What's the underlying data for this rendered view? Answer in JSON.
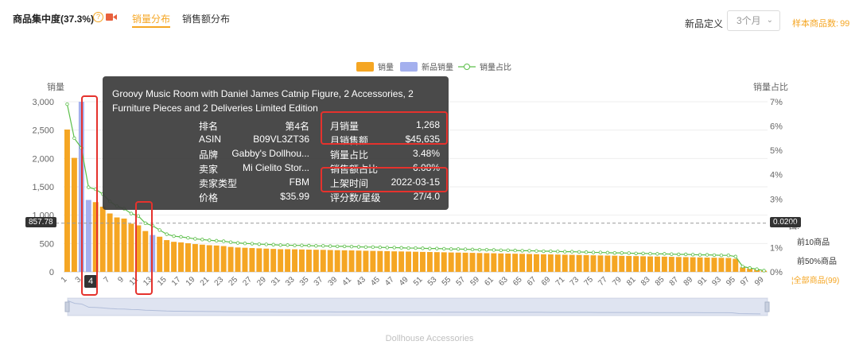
{
  "header": {
    "title": "商品集中度(37.3%)",
    "tabs": [
      {
        "label": "销量分布",
        "active": true
      },
      {
        "label": "销售额分布",
        "active": false
      }
    ],
    "newdef_label": "新品定义",
    "newdef_value": "3个月",
    "sample_label": "样本商品数:",
    "sample_count": "99"
  },
  "tooltip": {
    "name_line1": "Groovy Music Room with Daniel James Catnip Figure, 2 Accessories, 2",
    "name_line2": "Furniture Pieces and 2 Deliveries Limited Edition",
    "left": [
      {
        "k": "排名",
        "v": "第4名"
      },
      {
        "k": "ASIN",
        "v": "B09VL3ZT36"
      },
      {
        "k": "品牌",
        "v": "Gabby's Dollhou..."
      },
      {
        "k": "卖家",
        "v": "Mi Cielito Stor..."
      },
      {
        "k": "卖家类型",
        "v": "FBM"
      },
      {
        "k": "价格",
        "v": "$35.99"
      }
    ],
    "right": [
      {
        "k": "月销量",
        "v": "1,268"
      },
      {
        "k": "月销售额",
        "v": "$45,635"
      },
      {
        "k": "销量占比",
        "v": "3.48%"
      },
      {
        "k": "销售额占比",
        "v": "6.08%"
      },
      {
        "k": "上架时间",
        "v": "2022-03-15"
      },
      {
        "k": "评分数/星级",
        "v": "27/4.0"
      }
    ]
  },
  "pointers": {
    "y_left": "857.78",
    "y_right": "0.0200",
    "x": "4"
  },
  "side_legend": {
    "label_suffix": "围:",
    "items": [
      "前10商品",
      "前50%商品",
      "全部商品(99)"
    ]
  },
  "caption": "Dollhouse Accessories",
  "colors": {
    "bar": "#f5a623",
    "bar_new": "#a4b0ee",
    "line": "#5cbf4a",
    "accent": "#f5a623",
    "highlight": "#e5322d"
  },
  "chart_data": {
    "type": "bar",
    "ylabel": "销量",
    "ylabel_right": "销量占比",
    "ylim": [
      0,
      3000
    ],
    "yticks": [
      0,
      500,
      1000,
      1500,
      2000,
      2500,
      3000
    ],
    "ytick_labels": [
      "0",
      "500",
      "1,000",
      "1,500",
      "2,000",
      "2,500",
      "3,000"
    ],
    "ylim_right": [
      0,
      7
    ],
    "yticks_right_labels": [
      "0%",
      "1%",
      "2%",
      "3%",
      "4%",
      "5%",
      "6%",
      "7%"
    ],
    "xtick_labels": [
      "1",
      "3",
      "5",
      "7",
      "9",
      "11",
      "13",
      "15",
      "17",
      "19",
      "21",
      "23",
      "25",
      "27",
      "29",
      "31",
      "33",
      "35",
      "37",
      "39",
      "41",
      "43",
      "45",
      "47",
      "49",
      "51",
      "53",
      "55",
      "57",
      "59",
      "61",
      "63",
      "65",
      "67",
      "69",
      "71",
      "73",
      "75",
      "77",
      "79",
      "81",
      "83",
      "85",
      "87",
      "89",
      "91",
      "93",
      "95",
      "97",
      "99"
    ],
    "legend": [
      {
        "name": "销量",
        "kind": "bar"
      },
      {
        "name": "新品销量",
        "kind": "bar"
      },
      {
        "name": "销量占比",
        "kind": "line"
      }
    ],
    "legend_position": "top-center",
    "series": [
      {
        "name": "销量",
        "values": [
          2510,
          2010,
          1880,
          1268,
          1230,
          1150,
          1030,
          960,
          940,
          850,
          820,
          720,
          680,
          620,
          560,
          530,
          520,
          505,
          490,
          480,
          470,
          465,
          455,
          440,
          430,
          425,
          420,
          415,
          410,
          405,
          400,
          400,
          398,
          395,
          392,
          390,
          388,
          385,
          382,
          380,
          378,
          375,
          372,
          370,
          368,
          365,
          362,
          360,
          358,
          355,
          352,
          350,
          348,
          345,
          342,
          340,
          338,
          335,
          332,
          330,
          328,
          325,
          322,
          320,
          318,
          315,
          312,
          310,
          308,
          305,
          302,
          300,
          298,
          295,
          292,
          290,
          288,
          285,
          282,
          280,
          278,
          275,
          272,
          270,
          268,
          265,
          262,
          260,
          258,
          255,
          252,
          250,
          248,
          245,
          230,
          80,
          60,
          40,
          20
        ]
      },
      {
        "name": "新品销量",
        "values": [
          0,
          0,
          3000,
          1268,
          0,
          0,
          0,
          0,
          0,
          0,
          0,
          0,
          650,
          0,
          0,
          0,
          0,
          0,
          0,
          0,
          0,
          0,
          0,
          0,
          0,
          0,
          0,
          0,
          0,
          0,
          0,
          0,
          0,
          0,
          0,
          0,
          0,
          0,
          0,
          0,
          0,
          0,
          0,
          0,
          0,
          0,
          0,
          0,
          0,
          0,
          0,
          0,
          0,
          0,
          0,
          0,
          0,
          0,
          0,
          0,
          0,
          0,
          0,
          0,
          0,
          0,
          0,
          0,
          0,
          0,
          0,
          0,
          0,
          0,
          0,
          0,
          0,
          0,
          0,
          0,
          0,
          0,
          0,
          0,
          0,
          0,
          0,
          0,
          0,
          0,
          0,
          0,
          0,
          0,
          0,
          0,
          0,
          0,
          0
        ]
      },
      {
        "name": "销量占比",
        "values": [
          6.9,
          5.5,
          5.1,
          3.48,
          3.4,
          3.2,
          2.9,
          2.7,
          2.6,
          2.4,
          2.3,
          2.0,
          1.9,
          1.72,
          1.55,
          1.47,
          1.44,
          1.4,
          1.36,
          1.33,
          1.3,
          1.28,
          1.26,
          1.22,
          1.19,
          1.17,
          1.16,
          1.14,
          1.13,
          1.12,
          1.1,
          1.1,
          1.09,
          1.09,
          1.08,
          1.07,
          1.07,
          1.06,
          1.05,
          1.05,
          1.04,
          1.03,
          1.02,
          1.02,
          1.01,
          1.0,
          1.0,
          0.99,
          0.98,
          0.98,
          0.97,
          0.96,
          0.96,
          0.95,
          0.94,
          0.94,
          0.93,
          0.92,
          0.91,
          0.91,
          0.9,
          0.89,
          0.89,
          0.88,
          0.87,
          0.87,
          0.86,
          0.85,
          0.85,
          0.84,
          0.83,
          0.83,
          0.82,
          0.81,
          0.8,
          0.8,
          0.79,
          0.78,
          0.78,
          0.77,
          0.76,
          0.76,
          0.75,
          0.74,
          0.74,
          0.73,
          0.72,
          0.72,
          0.71,
          0.7,
          0.7,
          0.69,
          0.68,
          0.68,
          0.63,
          0.22,
          0.16,
          0.11,
          0.05
        ]
      }
    ]
  }
}
